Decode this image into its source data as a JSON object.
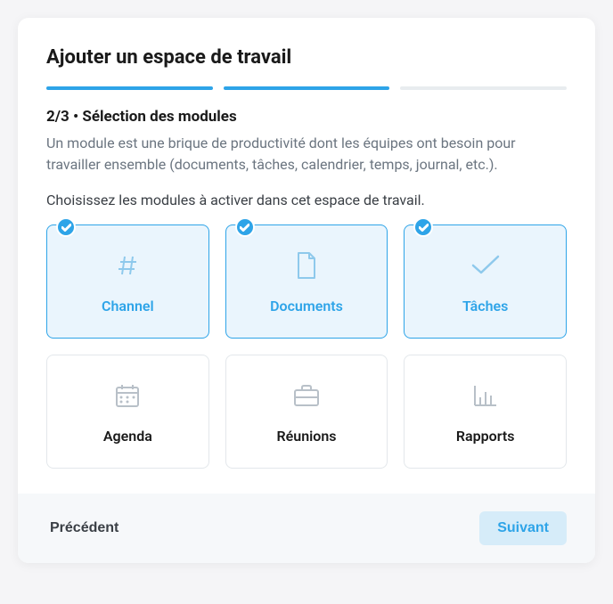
{
  "title": "Ajouter un espace de travail",
  "progress": {
    "segments": [
      true,
      true,
      false
    ]
  },
  "step": {
    "heading": "2/3 • Sélection des modules",
    "description": "Un module est une brique de productivité dont les équipes ont besoin pour travailler ensemble (documents, tâches, calendrier, temps, journal, etc.).",
    "instruction": "Choisissez les modules à activer dans cet espace de travail."
  },
  "modules": [
    {
      "label": "Channel",
      "selected": true,
      "icon": "hash-icon"
    },
    {
      "label": "Documents",
      "selected": true,
      "icon": "document-icon"
    },
    {
      "label": "Tâches",
      "selected": true,
      "icon": "check-icon"
    },
    {
      "label": "Agenda",
      "selected": false,
      "icon": "calendar-icon"
    },
    {
      "label": "Réunions",
      "selected": false,
      "icon": "briefcase-icon"
    },
    {
      "label": "Rapports",
      "selected": false,
      "icon": "chart-icon"
    }
  ],
  "footer": {
    "prev_label": "Précédent",
    "next_label": "Suivant"
  }
}
